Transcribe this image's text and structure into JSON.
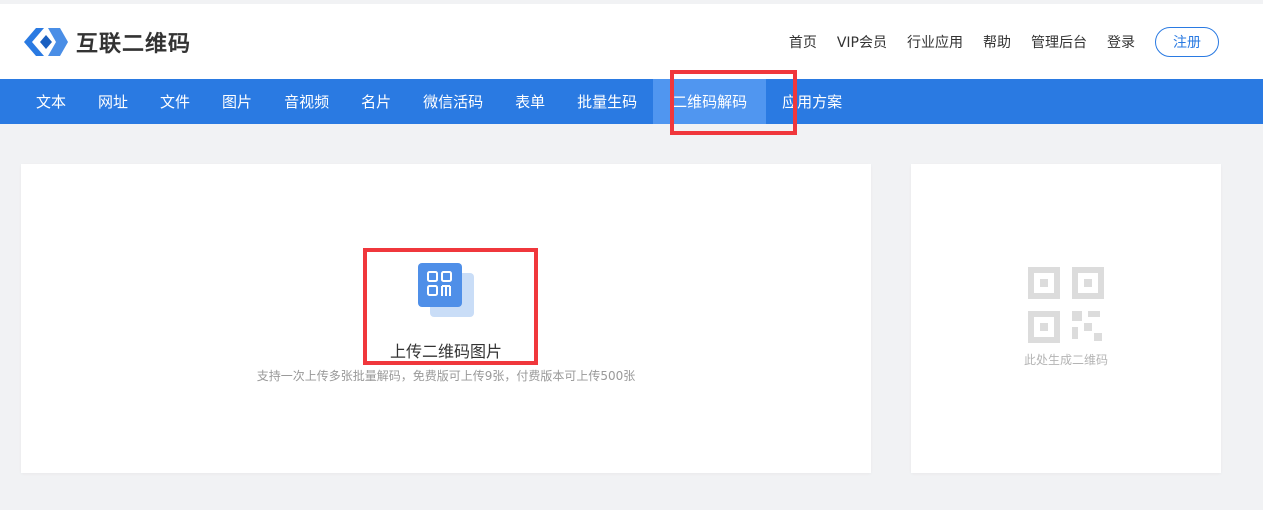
{
  "brand": {
    "name": "互联二维码",
    "color": "#2a7ae2"
  },
  "topnav": {
    "items": [
      "首页",
      "VIP会员",
      "行业应用",
      "帮助",
      "管理后台",
      "登录"
    ],
    "register": "注册"
  },
  "mainnav": {
    "tabs": [
      "文本",
      "网址",
      "文件",
      "图片",
      "音视频",
      "名片",
      "微信活码",
      "表单",
      "批量生码",
      "二维码解码",
      "应用方案"
    ],
    "active": "二维码解码"
  },
  "upload": {
    "label": "上传二维码图片",
    "hint": "支持一次上传多张批量解码，免费版可上传9张，付费版本可上传500张",
    "icon": "qr-upload-icon"
  },
  "result": {
    "hint": "此处生成二维码",
    "icon": "qr-code-placeholder-icon"
  },
  "colors": {
    "nav_bg": "#2a7ae2",
    "nav_active": "#5096f0",
    "highlight": "#f0373c"
  }
}
